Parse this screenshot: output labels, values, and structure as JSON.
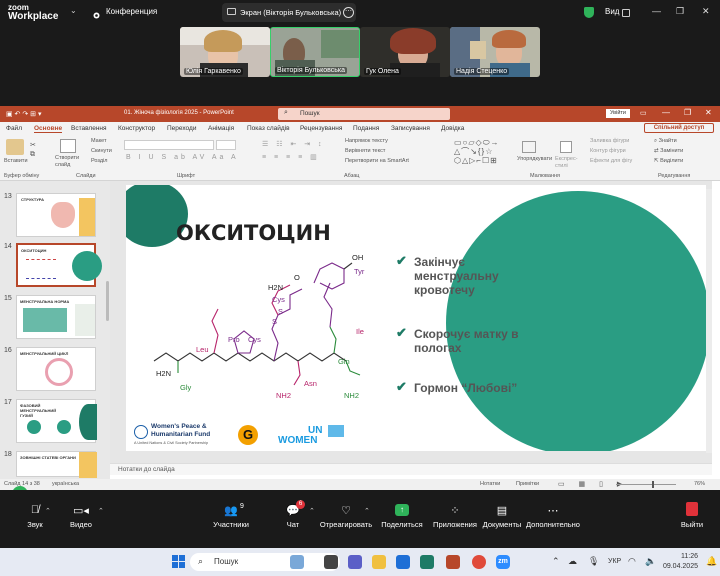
{
  "zoom": {
    "logo_line1": "zoom",
    "logo_line2": "Workplace",
    "conference": "Конференция",
    "share_label": "Экран (Вікторія Бульковська)",
    "view_label": "Вид",
    "participants": [
      {
        "name": "Юлія Гаркавенко"
      },
      {
        "name": "Вікторія Бульковська"
      },
      {
        "name": "Гук Олена"
      },
      {
        "name": "Надія Стеценко"
      }
    ],
    "toolbar": {
      "audio": "Звук",
      "video": "Видео",
      "participants": "Участники",
      "participants_count": "9",
      "chat": "Чат",
      "chat_badge": "6",
      "react": "Отреагировать",
      "share": "Поделиться",
      "apps": "Приложения",
      "docs": "Документы",
      "more": "Дополнительно",
      "leave": "Выйти"
    }
  },
  "ppt": {
    "title": "01. Жіноча фізіологія 2025  -  PowerPoint",
    "search": "Пошук",
    "signin": "Увійти",
    "share": "Спільний доступ",
    "menu": [
      "Файл",
      "Основне",
      "Вставлення",
      "Конструктор",
      "Переходи",
      "Анімація",
      "Показ слайдів",
      "Рецензування",
      "Подання",
      "Записування",
      "Довідка"
    ],
    "ribbon": {
      "paste": "Вставити",
      "clipboard": "Буфер обміну",
      "create_slide": "Створити слайд",
      "layout": "Макет",
      "reset": "Скинути",
      "section": "Розділ",
      "slides": "Слайди",
      "font": "Шрифт",
      "text_dir": "Напрямок тексту",
      "align_text": "Вирівняти текст",
      "smartart": "Перетворити на SmartArt",
      "paragraph": "Абзац",
      "arrange": "Упорядкувати",
      "quick_styles": "Експрес-стилі",
      "fill": "Заливка фігури",
      "outline": "Контур фігури",
      "effects": "Ефекти для фігу",
      "drawing": "Малювання",
      "find": "Знайти",
      "replace": "Замінити",
      "select": "Виділити",
      "editing": "Редагування"
    },
    "thumbs": [
      {
        "num": "13",
        "title": "СТРУКТУРА"
      },
      {
        "num": "14",
        "title": "ОКСИТОЦИН"
      },
      {
        "num": "15",
        "title": "МЕНСТРУАЛЬНА НОРМА"
      },
      {
        "num": "16",
        "title": "МЕНСТРУАЛЬНИЙ ЦИКЛ"
      },
      {
        "num": "17",
        "title": "ФАЗОВИЙ МЕНСТРУАЛЬНИЙ ГУЗИЙ"
      },
      {
        "num": "18",
        "title": "ЗОВНІШНІ СТАТЕВІ ОРГАНИ"
      }
    ],
    "slide": {
      "title": "ОКСИТОЦИН",
      "bullets": [
        "Закінчує менструальну кровотечу",
        "Скорочує матку в пологах",
        "Гормон “Любові”"
      ],
      "molecule_labels": {
        "oh": "OH",
        "tyr": "Tyr",
        "h2n_top": "H2N",
        "o1": "O",
        "cys1": "Cys",
        "s1": "S",
        "s2": "S",
        "cys2": "Cys",
        "pro": "Pro",
        "leu": "Leu",
        "ile": "Ile",
        "gln": "Gln",
        "asn": "Asn",
        "gly": "Gly",
        "h2n": "H2N",
        "nh2a": "NH2",
        "nh2b": "NH2",
        "h": "H",
        "n": "N"
      },
      "logos": {
        "wphf_line1": "Women's Peace &",
        "wphf_line2": "Humanitarian Fund",
        "wphf_small": "A United Nations & Civil Society Partnership",
        "g": "G",
        "unwomen": "WOMEN"
      }
    },
    "notes": "Нотатки до слайда",
    "status": {
      "slide": "Слайд 14 з 38",
      "lang": "українська",
      "notes_btn": "Нотатки",
      "comments_btn": "Примітки",
      "zoom": "76%"
    }
  },
  "taskbar": {
    "search": "Пошук",
    "lang": "УКР",
    "time": "11:26",
    "date": "09.04.2025"
  },
  "colors": {
    "teal": "#2a9d83",
    "ppt_red": "#b7472a",
    "zoom_dark": "#1a1a1a"
  }
}
